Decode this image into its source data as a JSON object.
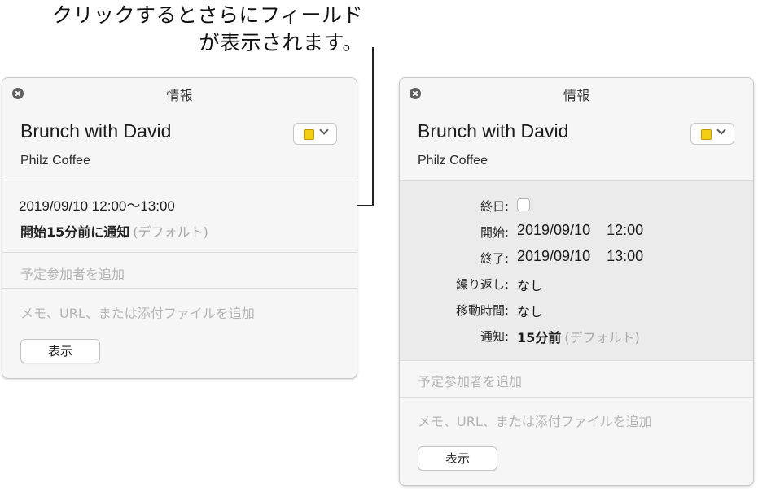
{
  "callout": {
    "line1": "クリックするとさらにフィールド",
    "line2": "が表示されます。"
  },
  "panel_collapsed": {
    "title": "情報",
    "event_name": "Brunch with David",
    "location": "Philz Coffee",
    "datetime": "2019/09/10 12:00〜13:00",
    "alert_main": "開始15分前に通知",
    "alert_default": "(デフォルト)",
    "add_invitees": "予定参加者を追加",
    "add_notes": "メモ、URL、または添付ファイルを追加",
    "show_button": "表示",
    "color": "#f3cc13"
  },
  "panel_expanded": {
    "title": "情報",
    "event_name": "Brunch with David",
    "location": "Philz Coffee",
    "all_day_label": "終日:",
    "all_day_checked": false,
    "start_label": "開始:",
    "start_date": "2019/09/10",
    "start_time": "12:00",
    "end_label": "終了:",
    "end_date": "2019/09/10",
    "end_time": "13:00",
    "repeat_label": "繰り返し:",
    "repeat_value": "なし",
    "travel_label": "移動時間:",
    "travel_value": "なし",
    "alert_label": "通知:",
    "alert_value": "15分前",
    "alert_default": "(デフォルト)",
    "add_invitees": "予定参加者を追加",
    "add_notes": "メモ、URL、または添付ファイルを追加",
    "show_button": "表示",
    "color": "#f3cc13"
  }
}
